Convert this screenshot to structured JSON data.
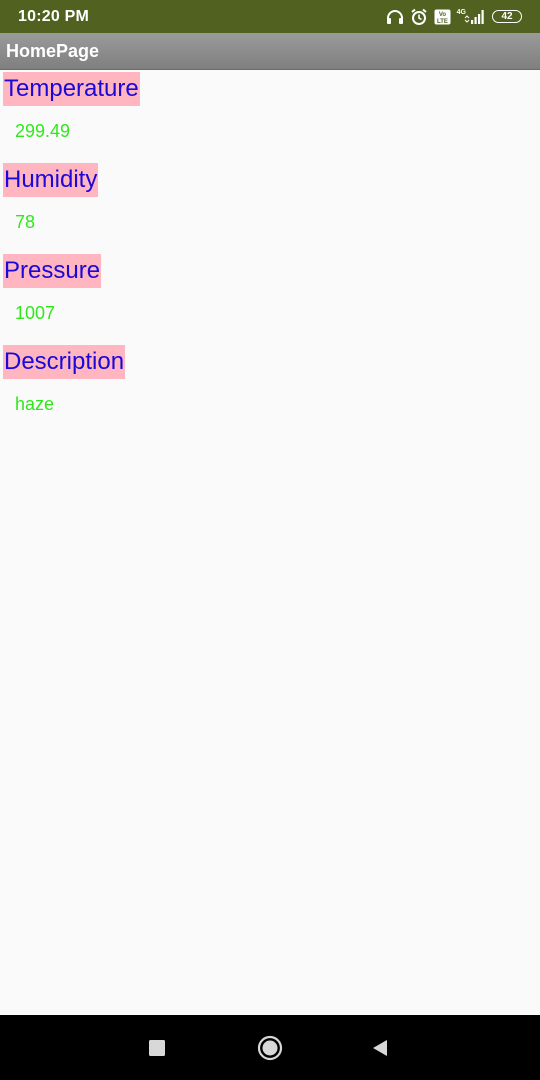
{
  "status_bar": {
    "time": "10:20 PM",
    "network": "4G",
    "battery": "42",
    "icons": [
      "headset-icon",
      "alarm-icon",
      "volte-icon",
      "signal-icon",
      "battery-icon"
    ]
  },
  "app": {
    "title": "HomePage"
  },
  "fields": [
    {
      "label": "Temperature",
      "value": "299.49"
    },
    {
      "label": "Humidity",
      "value": "78"
    },
    {
      "label": "Pressure",
      "value": "1007"
    },
    {
      "label": "Description",
      "value": "haze"
    }
  ],
  "colors": {
    "status_bar": "#506120",
    "label_background": "#ffb6c1",
    "label_text": "#1a09d9",
    "value_text": "#2fe81a"
  },
  "nav": {
    "buttons": [
      "recents-icon",
      "home-icon",
      "back-icon"
    ]
  }
}
